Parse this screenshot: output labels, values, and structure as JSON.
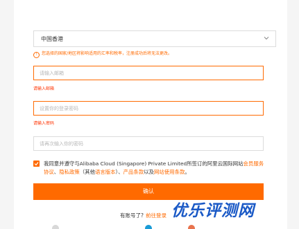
{
  "region": {
    "selected": "中国香港",
    "notice": "您选择的国家/地区将影响适用的汇率和税率，注册成功后将无法更改。"
  },
  "email": {
    "placeholder": "请输入邮箱",
    "error": "请输入邮箱"
  },
  "password": {
    "placeholder": "设置你的登录密码",
    "error": "请输入密码"
  },
  "confirm_password": {
    "placeholder": "请再次输入你的密码"
  },
  "agreement": {
    "prefix": "我同意并遵守与Alibaba Cloud (Singapore) Private Limited所签订的阿里云国际网站",
    "link_service": "会员服务协议",
    "sep1": "、",
    "link_privacy": "隐私政策",
    "paren_open": "（其他",
    "link_lang": "语言版本",
    "paren_close": "）、",
    "link_product": "产品条款",
    "and_text": "以及",
    "link_terms": "网站使用条款",
    "end": "。"
  },
  "submit_label": "确认",
  "login_prompt": {
    "text": "有账号了?",
    "link": "前往登录"
  },
  "watermark": "优乐评测网",
  "colors": {
    "accent": "#ff6a00",
    "error": "#ff3300",
    "watermark": "#1a59c6"
  },
  "icons": {
    "region_chevron": "chevron-down-icon",
    "notice": "info-circle-icon",
    "agree": "checkbox-checked-icon"
  }
}
